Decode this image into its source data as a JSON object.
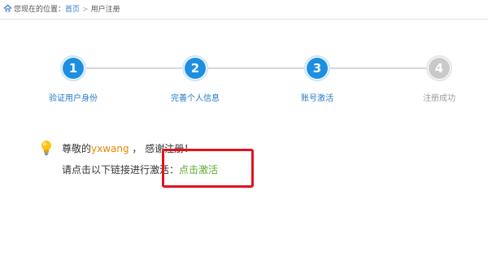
{
  "breadcrumb": {
    "prefix": "您现在的位置：",
    "home": "首页",
    "separator": ">",
    "current": "用户注册"
  },
  "steps": [
    {
      "number": "1",
      "label": "验证用户身份",
      "state": "done"
    },
    {
      "number": "2",
      "label": "完善个人信息",
      "state": "done"
    },
    {
      "number": "3",
      "label": "账号激活",
      "state": "current"
    },
    {
      "number": "4",
      "label": "注册成功",
      "state": "todo"
    }
  ],
  "message": {
    "greeting_prefix": "尊敬的",
    "username": "yxwang",
    "greeting_suffix": " ， 感谢注册！",
    "instruction": "请点击以下链接进行激活：",
    "activate_link": "点击激活"
  },
  "colors": {
    "step_active": "#1e8fe0",
    "step_inactive": "#c9c9c9",
    "username": "#f08300",
    "activate_link": "#5aaa2f",
    "highlight": "#e0141b"
  },
  "icons": {
    "home": "home-icon",
    "bulb": "lightbulb-icon"
  }
}
